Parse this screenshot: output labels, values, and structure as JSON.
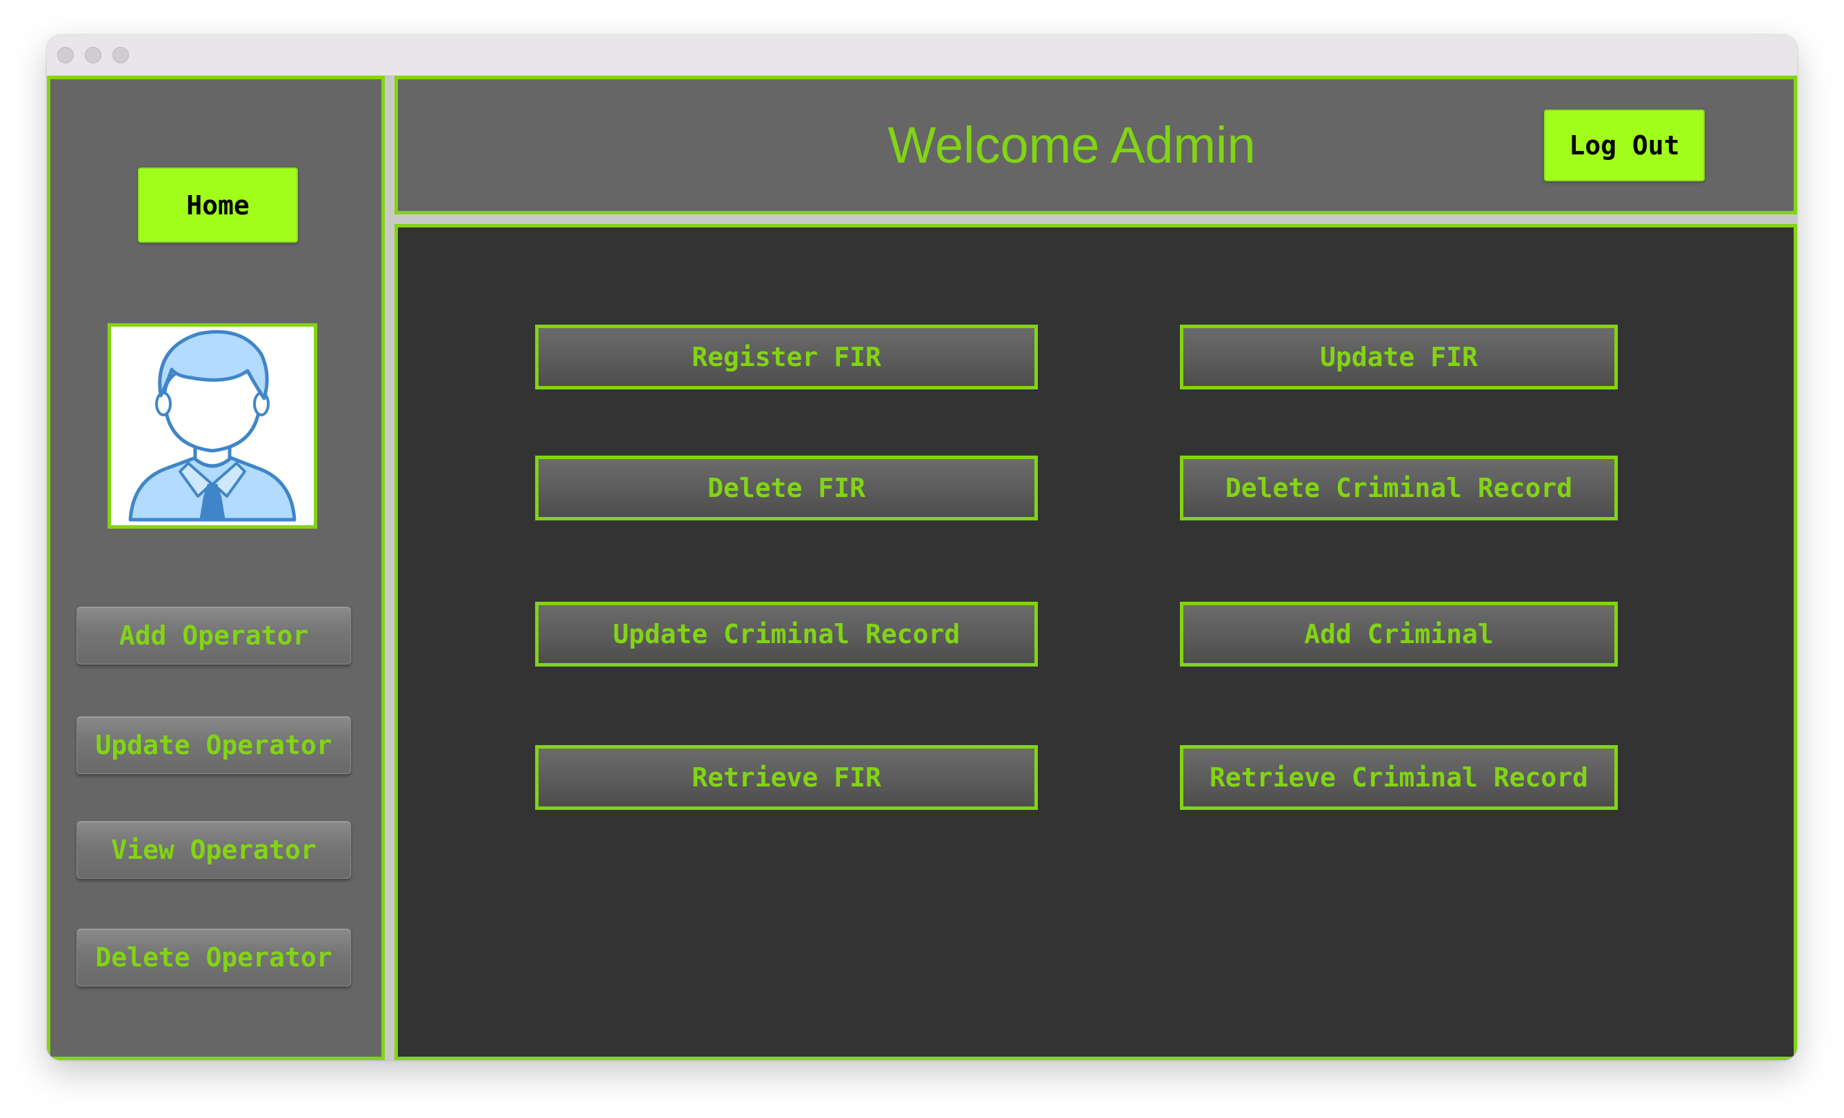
{
  "window": {
    "traffic_lights": [
      "close",
      "minimize",
      "zoom"
    ]
  },
  "header": {
    "title": "Welcome Admin",
    "logout_label": "Log Out"
  },
  "sidebar": {
    "home_label": "Home",
    "avatar_icon": "user-avatar-icon",
    "items": [
      {
        "label": "Add Operator"
      },
      {
        "label": "Update Operator"
      },
      {
        "label": "View Operator"
      },
      {
        "label": "Delete Operator"
      }
    ]
  },
  "main": {
    "actions": [
      {
        "label": "Register FIR"
      },
      {
        "label": "Update FIR"
      },
      {
        "label": "Delete FIR"
      },
      {
        "label": "Delete Criminal Record"
      },
      {
        "label": "Update Criminal Record"
      },
      {
        "label": "Add Criminal"
      },
      {
        "label": "Retrieve FIR"
      },
      {
        "label": "Retrieve Criminal Record"
      }
    ]
  },
  "colors": {
    "accent": "#82d414",
    "button_bright": "#a0fd1c",
    "panel": "#666666",
    "content_bg": "#333333"
  }
}
